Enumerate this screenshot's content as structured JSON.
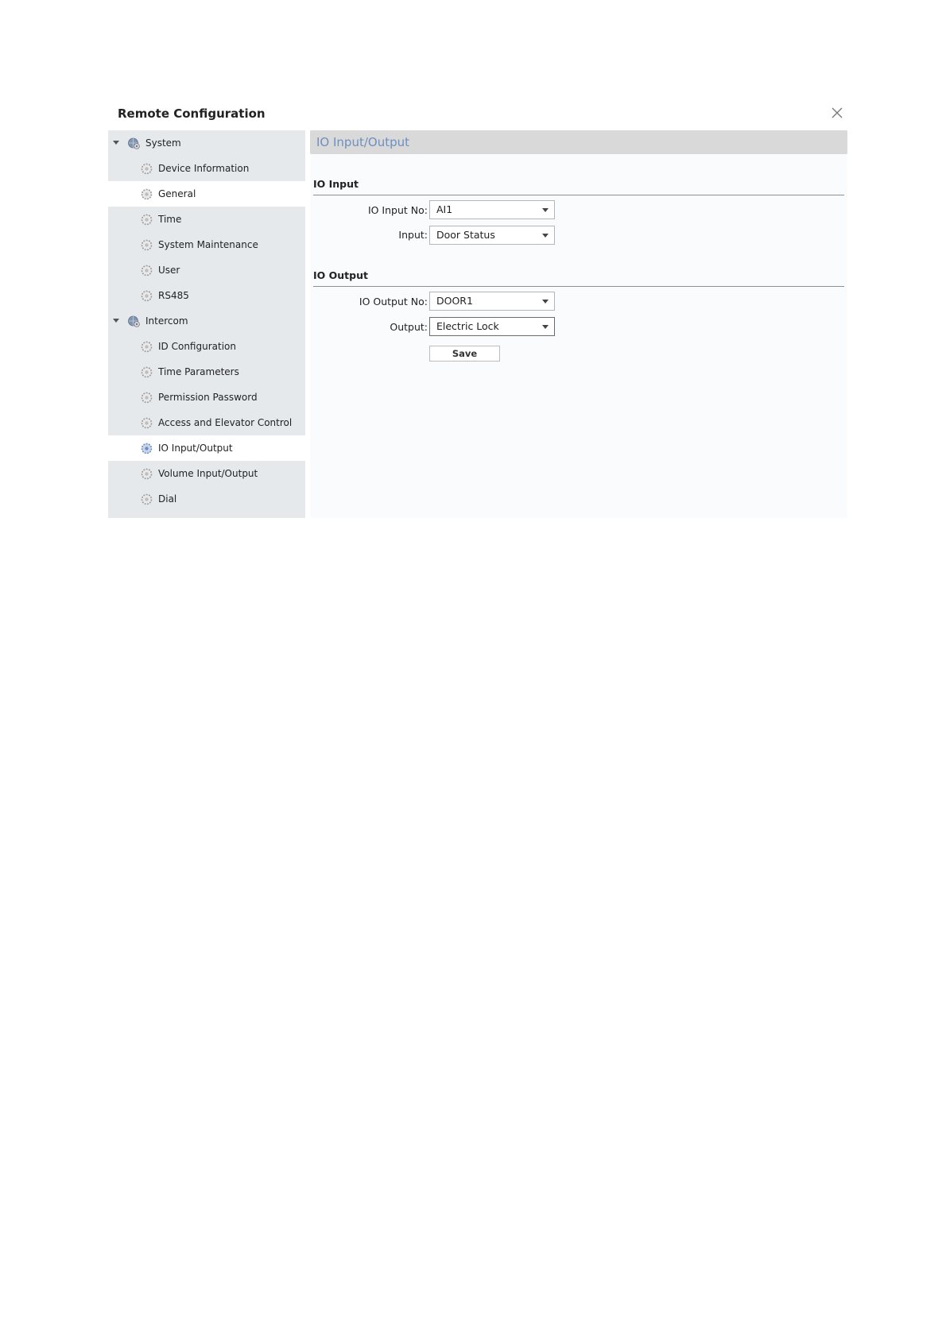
{
  "dialog": {
    "title": "Remote Configuration",
    "close_icon": "close-icon"
  },
  "sidebar": {
    "groups": [
      {
        "label": "System",
        "icon": "globe-gear-icon",
        "items": [
          {
            "label": "Device Information",
            "icon": "gear-icon"
          },
          {
            "label": "General",
            "icon": "gear-icon"
          },
          {
            "label": "Time",
            "icon": "gear-icon"
          },
          {
            "label": "System Maintenance",
            "icon": "gear-icon"
          },
          {
            "label": "User",
            "icon": "gear-icon"
          },
          {
            "label": "RS485",
            "icon": "gear-icon"
          }
        ]
      },
      {
        "label": "Intercom",
        "icon": "globe-gear-icon",
        "items": [
          {
            "label": "ID Configuration",
            "icon": "gear-icon"
          },
          {
            "label": "Time Parameters",
            "icon": "gear-icon"
          },
          {
            "label": "Permission Password",
            "icon": "gear-icon"
          },
          {
            "label": "Access and Elevator Control",
            "icon": "gear-icon"
          },
          {
            "label": "IO Input/Output",
            "icon": "gear-icon",
            "selected": true
          },
          {
            "label": "Volume Input/Output",
            "icon": "gear-icon"
          },
          {
            "label": "Dial",
            "icon": "gear-icon"
          }
        ]
      }
    ]
  },
  "main": {
    "header": "IO Input/Output",
    "io_input": {
      "title": "IO Input",
      "input_no_label": "IO Input No:",
      "input_no_value": "AI1",
      "input_label": "Input:",
      "input_value": "Door Status"
    },
    "io_output": {
      "title": "IO Output",
      "output_no_label": "IO Output No:",
      "output_no_value": "DOOR1",
      "output_label": "Output:",
      "output_value": "Electric Lock"
    },
    "save_label": "Save"
  },
  "colors": {
    "sidebar_bg": "#e6e9ec",
    "header_bg": "#d9d9d9",
    "header_text": "#6d8fbf",
    "selected_bg": "#ffffff"
  }
}
